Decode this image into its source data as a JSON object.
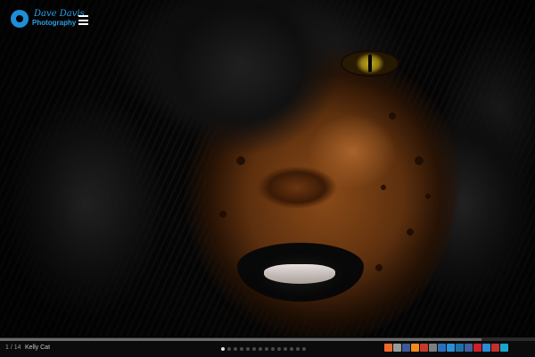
{
  "logo": {
    "line1": "Dave Davis",
    "line2": "Photography",
    "icon": "aperture-icon",
    "color": "#2aa0e8"
  },
  "menu": {
    "icon": "hamburger-menu-icon"
  },
  "slideshow": {
    "counter": "1 / 14",
    "caption": "Kelly Cat",
    "current": 1,
    "total": 14,
    "progress": 0.9
  },
  "social": [
    {
      "icon": "share-icon",
      "color": "#f0672c"
    },
    {
      "icon": "email-icon",
      "color": "#9a9a9a"
    },
    {
      "icon": "facebook-icon",
      "color": "#3b5998"
    },
    {
      "icon": "rss-icon",
      "color": "#f28a1e"
    },
    {
      "icon": "google-plus-icon",
      "color": "#c43b2b"
    },
    {
      "icon": "share-alt-icon",
      "color": "#7d7d7d"
    },
    {
      "icon": "digg-icon",
      "color": "#2a6fb8"
    },
    {
      "icon": "stumbleupon-icon",
      "color": "#2b8fd4"
    },
    {
      "icon": "linkedin-icon",
      "color": "#1d6fa8"
    },
    {
      "icon": "myspace-icon",
      "color": "#3f5f9d"
    },
    {
      "icon": "pinterest-icon",
      "color": "#cb2027"
    },
    {
      "icon": "delicious-icon",
      "color": "#2d8ad6"
    },
    {
      "icon": "youtube-icon",
      "color": "#c4302b"
    },
    {
      "icon": "vimeo-icon",
      "color": "#17a7c9"
    }
  ]
}
